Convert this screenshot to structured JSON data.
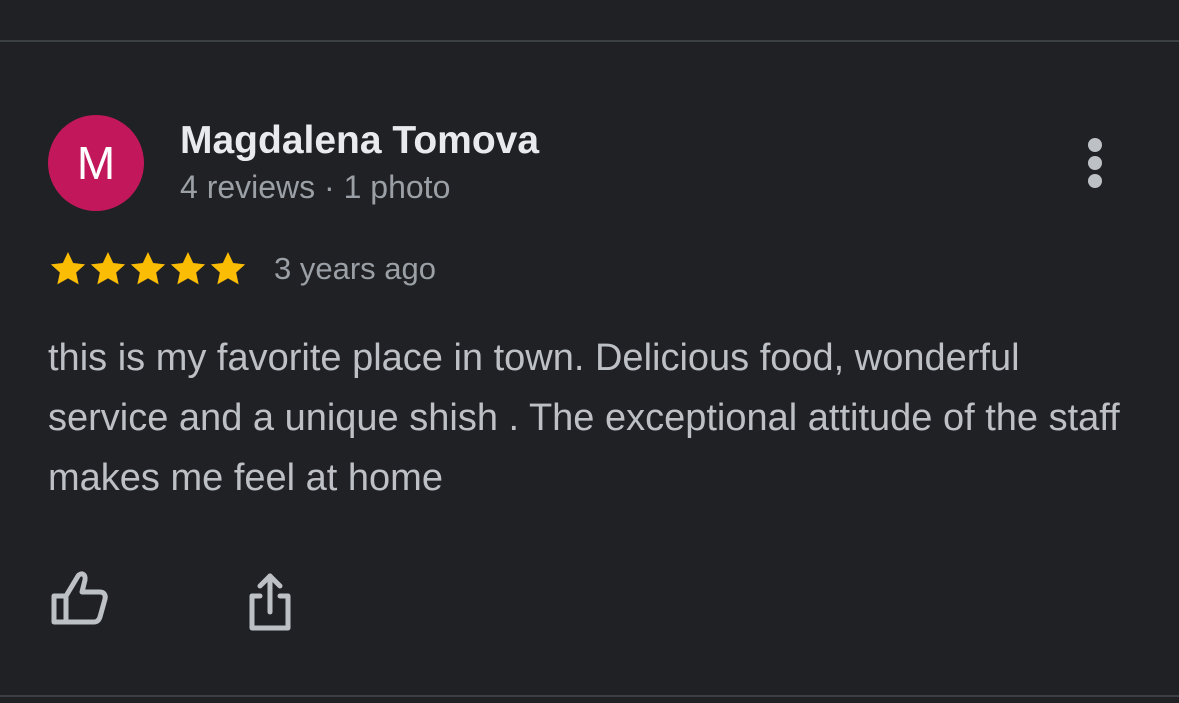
{
  "review": {
    "author": {
      "initial": "M",
      "name": "Magdalena Tomova",
      "meta": "4 reviews · 1 photo",
      "avatar_color": "#c2185b"
    },
    "rating": 5,
    "rating_max": 5,
    "time_ago": "3 years ago",
    "text": "this is my favorite place in town. Delicious food, wonderful service and a unique shish . The exceptional attitude of the staff makes me feel at home"
  },
  "icons": {
    "more": "more-vert-icon",
    "like": "thumb-up-icon",
    "share": "share-icon",
    "star": "star-icon"
  },
  "colors": {
    "background": "#202124",
    "star": "#fbbc04",
    "divider": "#3c4043",
    "secondary_text": "#9aa0a6"
  }
}
